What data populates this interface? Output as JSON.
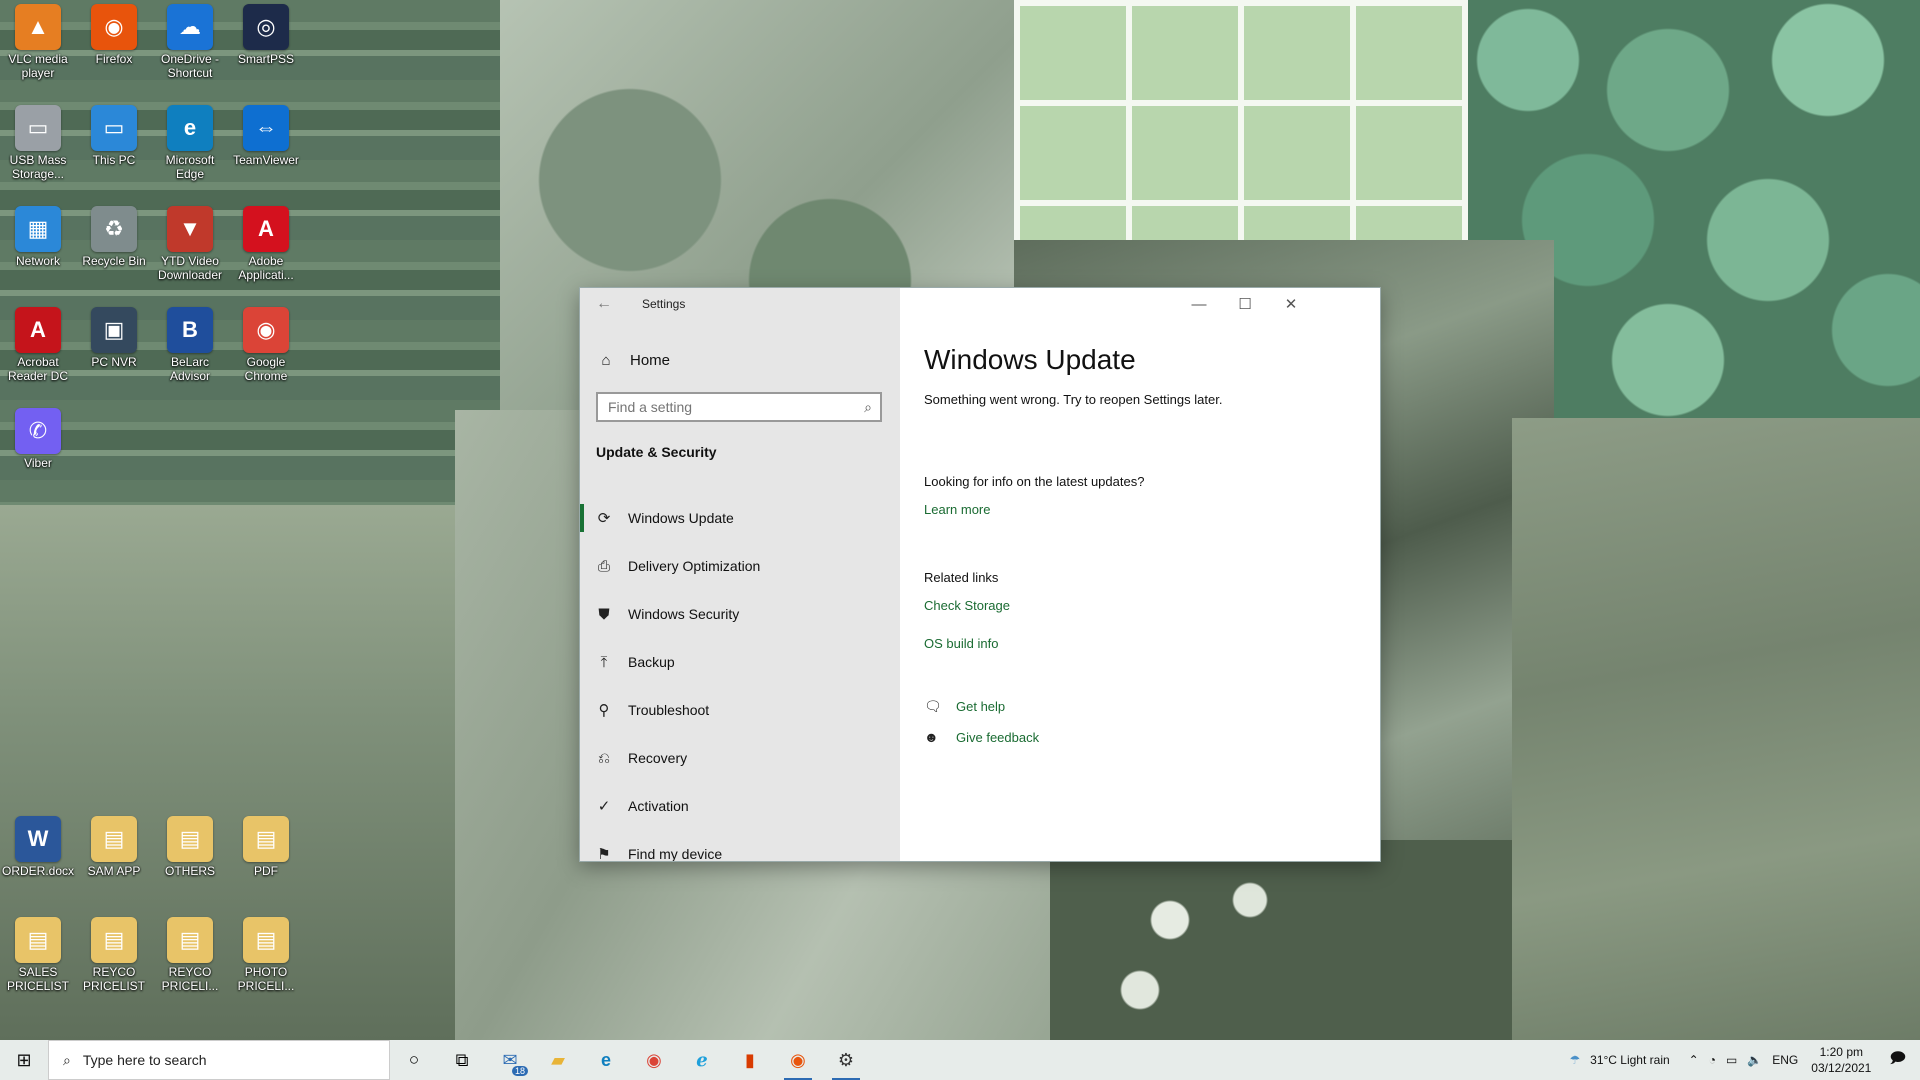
{
  "desktop_icons": [
    {
      "label": "VLC media player",
      "color": "#e67e22",
      "glyph": "▲"
    },
    {
      "label": "Firefox",
      "color": "#e8540c",
      "glyph": "◉"
    },
    {
      "label": "OneDrive - Shortcut",
      "color": "#1a73d6",
      "glyph": "☁"
    },
    {
      "label": "SmartPSS",
      "color": "#1d2b4a",
      "glyph": "◎"
    },
    {
      "label": "USB Mass Storage...",
      "color": "#9aa0a6",
      "glyph": "▭"
    },
    {
      "label": "This PC",
      "color": "#2b88d8",
      "glyph": "▭"
    },
    {
      "label": "Microsoft Edge",
      "color": "#0f7fbf",
      "glyph": "e"
    },
    {
      "label": "TeamViewer",
      "color": "#0e6fd1",
      "glyph": "⇔"
    },
    {
      "label": "Network",
      "color": "#2b88d8",
      "glyph": "▦"
    },
    {
      "label": "Recycle Bin",
      "color": "#7f8c8d",
      "glyph": "♻"
    },
    {
      "label": "YTD Video Downloader",
      "color": "#c0392b",
      "glyph": "▼"
    },
    {
      "label": "Adobe Applicati...",
      "color": "#d4111e",
      "glyph": "A"
    },
    {
      "label": "Acrobat Reader DC",
      "color": "#c5141b",
      "glyph": "A"
    },
    {
      "label": "PC NVR",
      "color": "#34495e",
      "glyph": "▣"
    },
    {
      "label": "BeLarc Advisor",
      "color": "#1f4e9c",
      "glyph": "B"
    },
    {
      "label": "Google Chrome",
      "color": "#db4437",
      "glyph": "◉"
    },
    {
      "label": "Viber",
      "color": "#7360f2",
      "glyph": "✆"
    },
    {
      "label": "ORDER.docx",
      "color": "#2b579a",
      "glyph": "W"
    },
    {
      "label": "SAM APP",
      "color": "#e8c468",
      "glyph": "▤"
    },
    {
      "label": "OTHERS",
      "color": "#e8c468",
      "glyph": "▤"
    },
    {
      "label": "PDF",
      "color": "#e8c468",
      "glyph": "▤"
    },
    {
      "label": "SALES PRICELIST",
      "color": "#e8c468",
      "glyph": "▤"
    },
    {
      "label": "REYCO PRICELIST",
      "color": "#e8c468",
      "glyph": "▤"
    },
    {
      "label": "REYCO PRICELI...",
      "color": "#e8c468",
      "glyph": "▤"
    },
    {
      "label": "PHOTO PRICELI...",
      "color": "#e8c468",
      "glyph": "▤"
    }
  ],
  "settings": {
    "window_title": "Settings",
    "back_icon": "back-arrow-icon",
    "home_label": "Home",
    "search": {
      "placeholder": "Find a setting",
      "value": ""
    },
    "section_heading": "Update & Security",
    "nav_items": [
      {
        "label": "Windows Update",
        "icon": "⟳",
        "selected": true
      },
      {
        "label": "Delivery Optimization",
        "icon": "⎙",
        "selected": false
      },
      {
        "label": "Windows Security",
        "icon": "⛊",
        "selected": false
      },
      {
        "label": "Backup",
        "icon": "⤒",
        "selected": false
      },
      {
        "label": "Troubleshoot",
        "icon": "⚲",
        "selected": false
      },
      {
        "label": "Recovery",
        "icon": "⎌",
        "selected": false
      },
      {
        "label": "Activation",
        "icon": "✓",
        "selected": false
      },
      {
        "label": "Find my device",
        "icon": "⚑",
        "selected": false
      }
    ],
    "page_title": "Windows Update",
    "error_message": "Something went wrong. Try to reopen Settings later.",
    "info_question": "Looking for info on the latest updates?",
    "learn_more": "Learn more",
    "related_heading": "Related links",
    "check_storage": "Check Storage",
    "os_build_info": "OS build info",
    "get_help": "Get help",
    "give_feedback": "Give feedback",
    "accent_color": "#197235"
  },
  "taskbar": {
    "search_placeholder": "Type here to search",
    "mail_badge": "18",
    "weather": "31°C  Light rain",
    "language": "ENG",
    "time": "1:20 pm",
    "date": "03/12/2021"
  }
}
